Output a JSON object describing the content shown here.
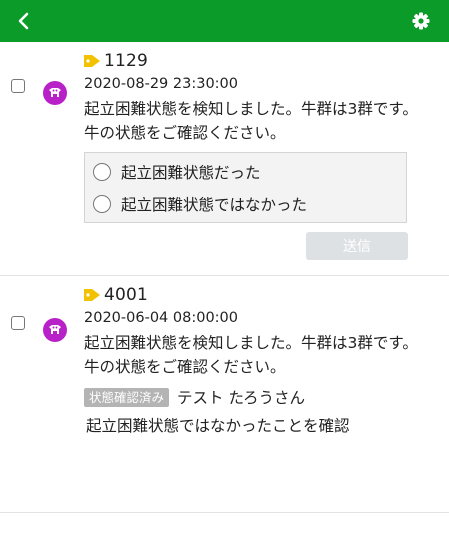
{
  "colors": {
    "header_bg": "#0a9b28",
    "avatar_bg": "#b821c8",
    "tag_icon": "#f2c200",
    "send_button_bg": "#dde1e4",
    "status_badge_bg": "#b4b4b4"
  },
  "header": {
    "back_icon": "chevron-left-icon",
    "settings_icon": "gear-icon"
  },
  "notifications": [
    {
      "cow_id": "1129",
      "timestamp": "2020-08-29 23:30:00",
      "message": "起立困難状態を検知しました。牛群は3群です。牛の状態をご確認ください。",
      "options": [
        "起立困難状態だった",
        "起立困難状態ではなかった"
      ],
      "send_label": "送信"
    },
    {
      "cow_id": "4001",
      "timestamp": "2020-06-04 08:00:00",
      "message": "起立困難状態を検知しました。牛群は3群です。牛の状態をご確認ください。",
      "status_badge": "状態確認済み",
      "confirmed_by": "テスト たろうさん",
      "result": "起立困難状態ではなかったことを確認"
    }
  ]
}
